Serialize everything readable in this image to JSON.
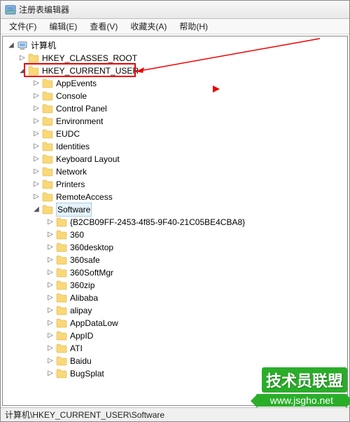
{
  "window": {
    "title": "注册表编辑器"
  },
  "menu": {
    "file": "文件(F)",
    "edit": "编辑(E)",
    "view": "查看(V)",
    "favorites": "收藏夹(A)",
    "help": "帮助(H)"
  },
  "tree": {
    "root": "计算机",
    "hives": {
      "hkcr": "HKEY_CLASSES_ROOT",
      "hkcu": "HKEY_CURRENT_USER"
    },
    "hkcu_children": [
      "AppEvents",
      "Console",
      "Control Panel",
      "Environment",
      "EUDC",
      "Identities",
      "Keyboard Layout",
      "Network",
      "Printers",
      "RemoteAccess",
      "Software"
    ],
    "software_children": [
      "{B2CB09FF-2453-4f85-9F40-21C05BE4CBA8}",
      "360",
      "360desktop",
      "360safe",
      "360SoftMgr",
      "360zip",
      "Alibaba",
      "alipay",
      "AppDataLow",
      "AppID",
      "ATI",
      "Baidu",
      "BugSplat"
    ]
  },
  "statusbar": {
    "path": "计算机\\HKEY_CURRENT_USER\\Software"
  },
  "watermark": {
    "text": "技术员联盟",
    "url": "www.jsgho.net"
  }
}
